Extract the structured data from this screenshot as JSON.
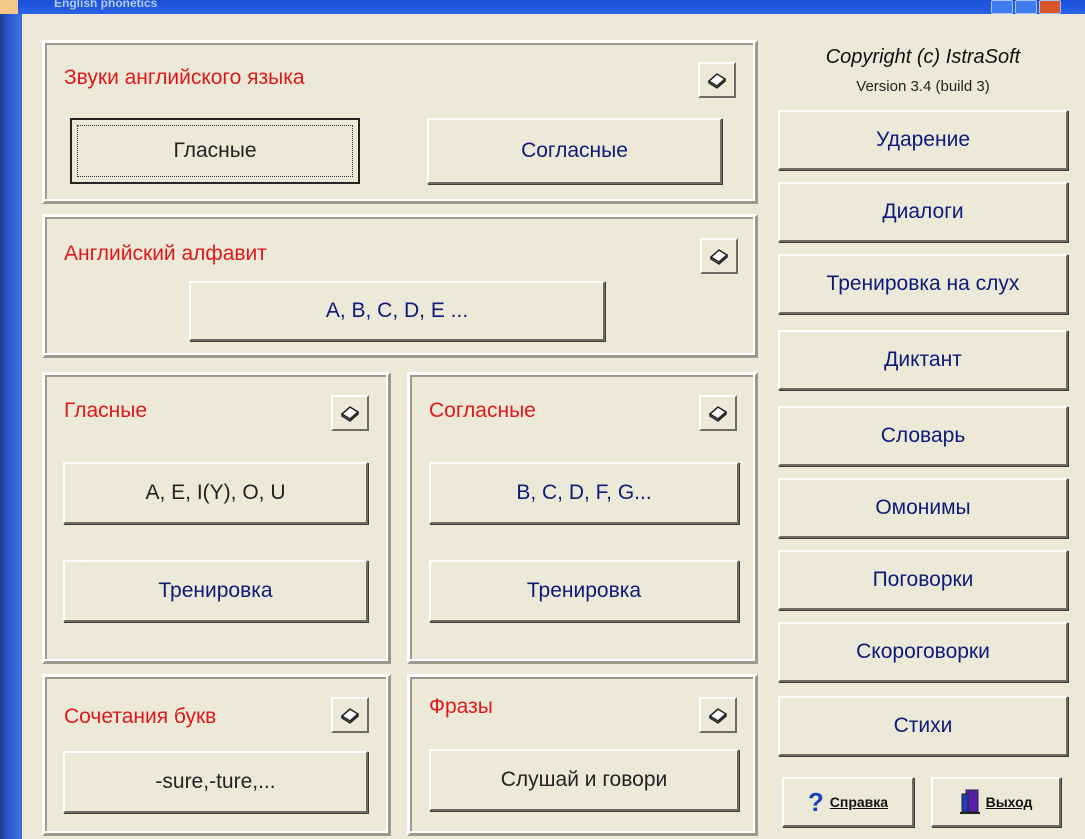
{
  "window": {
    "title": "English phonetics"
  },
  "copyright": {
    "text": "Copyright (c) IstraSoft",
    "version": "Version 3.4 (build 3)"
  },
  "sections": {
    "sounds": {
      "title": "Звуки английского языка",
      "vowels_button": "Гласные",
      "consonants_button": "Согласные"
    },
    "alphabet": {
      "title": "Английский алфавит",
      "button": "A, B, C, D, E ..."
    },
    "vowels": {
      "title": "Гласные",
      "letters_button": "A, E, I(Y), O, U",
      "training_button": "Тренировка"
    },
    "consonants": {
      "title": "Согласные",
      "letters_button": "B, C, D, F, G...",
      "training_button": "Тренировка"
    },
    "combinations": {
      "title": "Сочетания букв",
      "button": "-sure,-ture,..."
    },
    "phrases": {
      "title": "Фразы",
      "button": "Слушай и говори"
    }
  },
  "sidebar": {
    "items": [
      "Ударение",
      "Диалоги",
      "Тренировка на слух",
      "Диктант",
      "Словарь",
      "Омонимы",
      "Поговорки",
      "Скороговорки",
      "Стихи"
    ]
  },
  "footer": {
    "help": {
      "label": "Справка",
      "icon": "question-icon"
    },
    "exit": {
      "label": "Выход",
      "icon": "exit-door-icon"
    }
  },
  "colors": {
    "title_red": "#e0181a",
    "button_text": "#0c1b78",
    "window_bg": "#ece9d8",
    "desktop": "#f2b870"
  }
}
